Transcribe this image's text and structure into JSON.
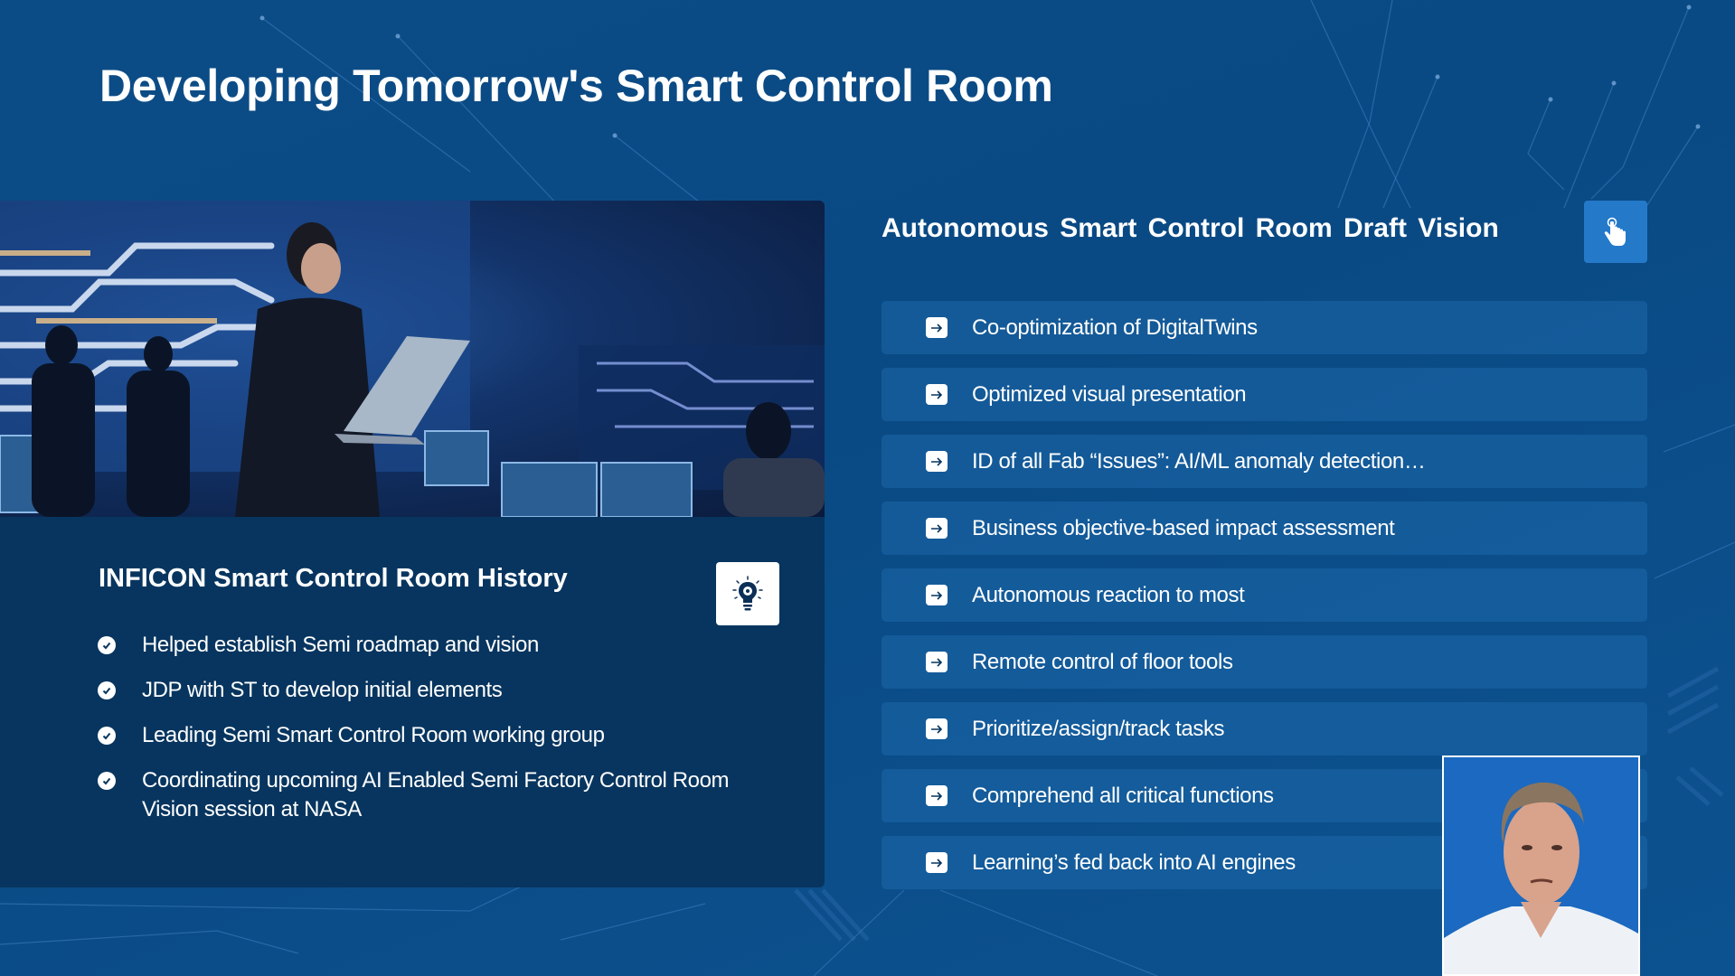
{
  "slide": {
    "title": "Developing Tomorrow's Smart Control Room"
  },
  "history": {
    "heading": "INFICON Smart Control Room History",
    "icon": "lightbulb-gear-icon",
    "items": [
      "Helped establish Semi roadmap and vision",
      "JDP with ST to develop initial elements",
      "Leading Semi Smart Control Room working group",
      "Coordinating upcoming AI Enabled Semi Factory Control Room Vision session at NASA"
    ]
  },
  "vision": {
    "heading": "Autonomous Smart Control Room Draft Vision",
    "icon": "hand-pointer-icon",
    "item_icon": "arrow-right-icon",
    "items": [
      "Co-optimization of DigitalTwins",
      "Optimized visual presentation",
      "ID of all Fab “Issues”: AI/ML anomaly detection…",
      "Business objective-based impact assessment",
      "Autonomous reaction to most",
      "Remote control of floor tools",
      "Prioritize/assign/track tasks",
      "Comprehend all critical functions",
      "Learning’s fed back into AI engines"
    ]
  },
  "photo": {
    "description": "Control room operator with laptop in front of monitor wall"
  },
  "video": {
    "description": "Presenter webcam feed"
  },
  "colors": {
    "background": "#0a4a84",
    "card": "#07355f",
    "list_item": "#13568f",
    "accent_button": "#2479c9",
    "text": "#ffffff"
  }
}
